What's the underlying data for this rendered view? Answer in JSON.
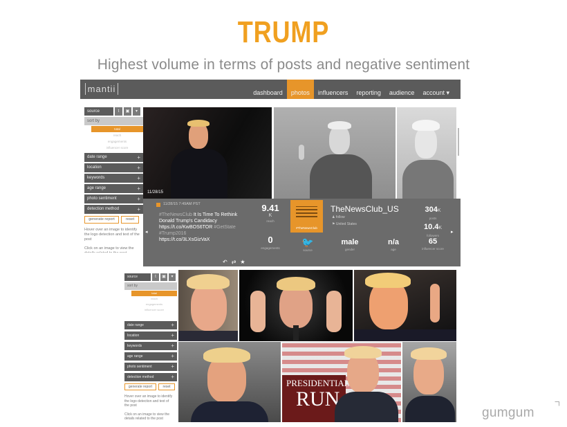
{
  "slide": {
    "title": "TRUMP",
    "subtitle": "Highest volume in terms of posts and negative sentiment",
    "brand": "gumgum",
    "accent_color": "#f0a020"
  },
  "app": {
    "logo": "mantii",
    "nav": [
      "dashboard",
      "photos",
      "influencers",
      "reporting",
      "audience",
      "account ▾"
    ],
    "nav_active": "photos",
    "nav_bg": "#5b5b5b",
    "active_color": "#e7952a"
  },
  "sidebar": {
    "source_label": "source",
    "source_icons": [
      "t",
      "▣",
      "▾"
    ],
    "sort_label": "sort by",
    "sort_options": [
      "total",
      "reach",
      "engagements",
      "influencer score"
    ],
    "filters": [
      "date range",
      "location",
      "keywords",
      "age range",
      "photo sentiment",
      "detection method"
    ],
    "generate_label": "generate report",
    "reset_label": "reset",
    "hint1": "Hover over an image to identify the logo detection and text of the post",
    "hint2": "Click on an image to view the details related to the post"
  },
  "photos": {
    "selected_date": "11/28/15"
  },
  "post": {
    "timestamp": "11/28/15 7:49AM PST",
    "handle": "#TheNewsClub",
    "headline": "It Is Time To Rethink Donald Trump's Candidacy",
    "link1": "https://t.co/KwBOS6TOR",
    "tags": "#GetState #Trump2016",
    "link2": "https://t.co/3LXsGizVaX"
  },
  "stats": {
    "reach_value": "9.41",
    "reach_unit": "K",
    "reach_label": "reach",
    "engagements_value": "0",
    "engagements_label": "engagements",
    "network_label": "source",
    "gender_value": "male",
    "gender_label": "gender",
    "age_value": "n/a",
    "age_label": "age"
  },
  "account": {
    "name": "TheNewsClub_US",
    "logo_tag": "#TheNewsClub",
    "follow": "follow",
    "country": "United States",
    "posts_value": "304",
    "posts_unit": "K",
    "posts_label": "posts",
    "followers_value": "10.4",
    "followers_unit": "K",
    "followers_label": "followers",
    "score_value": "65",
    "score_label": "influencer score"
  },
  "collage": {
    "banner_line1": "PRESIDENTIAL",
    "banner_line2": "RUN"
  }
}
